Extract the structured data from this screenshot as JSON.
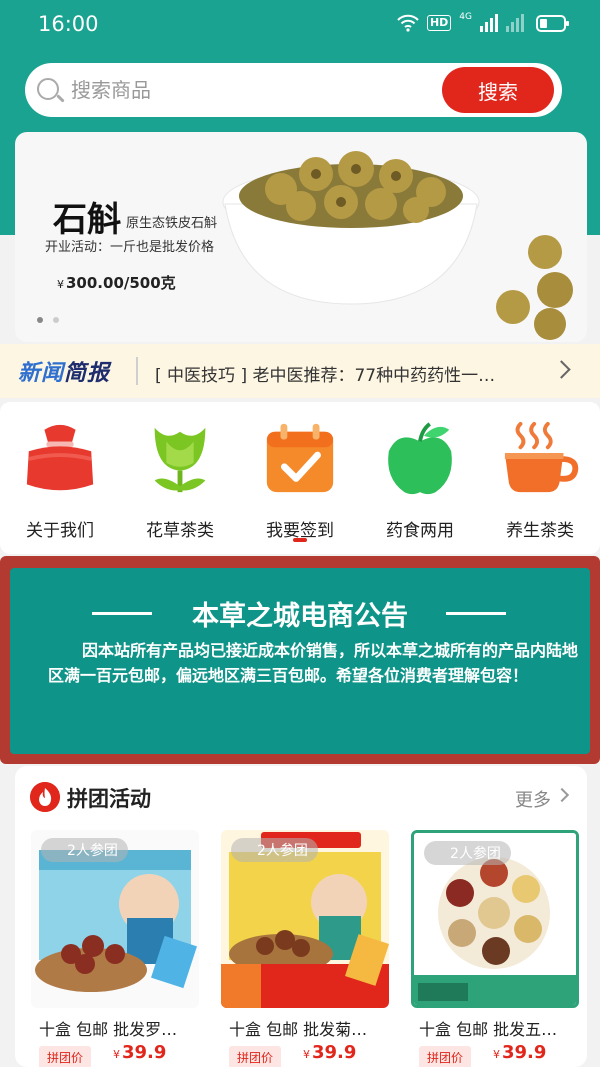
{
  "status_bar": {
    "time": "16:00",
    "hd_label": "HD",
    "network_label": "4G"
  },
  "search": {
    "placeholder": "搜索商品",
    "button_label": "搜索"
  },
  "banner": {
    "title": "石斛",
    "subtitle": "原生态铁皮石斛",
    "promo": "开业活动：一斤也是批发价格",
    "currency": "¥",
    "price": "300.00/500克"
  },
  "news": {
    "logo_part1": "新闻",
    "logo_part2": "简报",
    "headline": "[ 中医技巧 ] 老中医推荐：77种中药药性一…"
  },
  "categories": [
    {
      "label": "关于我们",
      "icon": "bag-icon"
    },
    {
      "label": "花草茶类",
      "icon": "flower-icon"
    },
    {
      "label": "我要签到",
      "icon": "calendar-check-icon"
    },
    {
      "label": "药食两用",
      "icon": "apple-icon"
    },
    {
      "label": "养生茶类",
      "icon": "tea-cup-icon"
    }
  ],
  "notice": {
    "title": "本草之城电商公告",
    "body": "因本站所有产品均已接近成本价销售，所以本草之城所有的产品内陆地区满一百元包邮，偏远地区满三百包邮。希望各位消费者理解包容！"
  },
  "group_buy": {
    "title": "拼团活动",
    "more_label": "更多",
    "products": [
      {
        "badge": "2人参团",
        "name": "十盒 包邮 批发罗…",
        "tag": "拼团价",
        "currency": "¥",
        "price": "39.9"
      },
      {
        "badge": "2人参团",
        "name": "十盒 包邮 批发菊…",
        "tag": "拼团价",
        "currency": "¥",
        "price": "39.9"
      },
      {
        "badge": "2人参团",
        "name": "十盒 包邮 批发五…",
        "tag": "拼团价",
        "currency": "¥",
        "price": "39.9"
      }
    ]
  },
  "colors": {
    "brand_teal": "#1aa391",
    "accent_red": "#e1261c"
  }
}
